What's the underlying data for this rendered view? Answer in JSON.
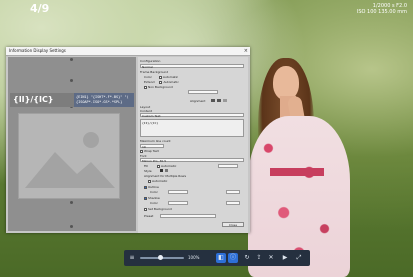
{
  "viewer": {
    "counter": "4/9",
    "exif_line1": "1/2000 s  F2.0",
    "exif_line2": "ISO 100  135.00 mm"
  },
  "dialog": {
    "title": "Information Display Settings",
    "close_glyph": "×",
    "overlay_label": "{II}/{IC}",
    "overlay_code_line1": "{EIN1} \"{ISHT*.F*.BS}\" \"(",
    "overlay_code_line2": "{ISOAP*.ISO*.GS*.*SPL}",
    "settings": {
      "configuration_label": "Configuration",
      "configuration_value": "Normal",
      "frame_background_label": "Frame Background",
      "color_label": "Color",
      "automatic_label": "Automatic",
      "extend_label": "Extend",
      "no_background_label": "Non Background",
      "alignment_label": "Alignment",
      "layout_label": "Layout",
      "content_label": "Content",
      "custom_text_label": "Custom Text",
      "custom_text_value": "{II}/{IC}",
      "maximum_lines_label": "Maximum line count",
      "maximum_lines_value": "10",
      "wrap_label": "Wrap Text",
      "font_label": "Font",
      "font_value": "Minion Pro, 30.5",
      "fill_label": "Fill",
      "style_label": "Style",
      "alignment_multiple_label": "Alignment for Multiple Rows",
      "outline_label": "Outline",
      "shadow_label": "Shadow",
      "set_background_label": "Set Background",
      "preset_label": "Preset",
      "close_button": "Close"
    }
  },
  "taskbar": {
    "zoom_text": "100%",
    "buttons": [
      "prev",
      "next",
      "info",
      "rotate",
      "share",
      "fullscreen"
    ]
  },
  "colors": {
    "dialog_bg": "#c7c7c7",
    "overlay_code_bg": "#5d6b86",
    "taskbar_bg": "#25303f",
    "accent": "#2d6fd6"
  }
}
